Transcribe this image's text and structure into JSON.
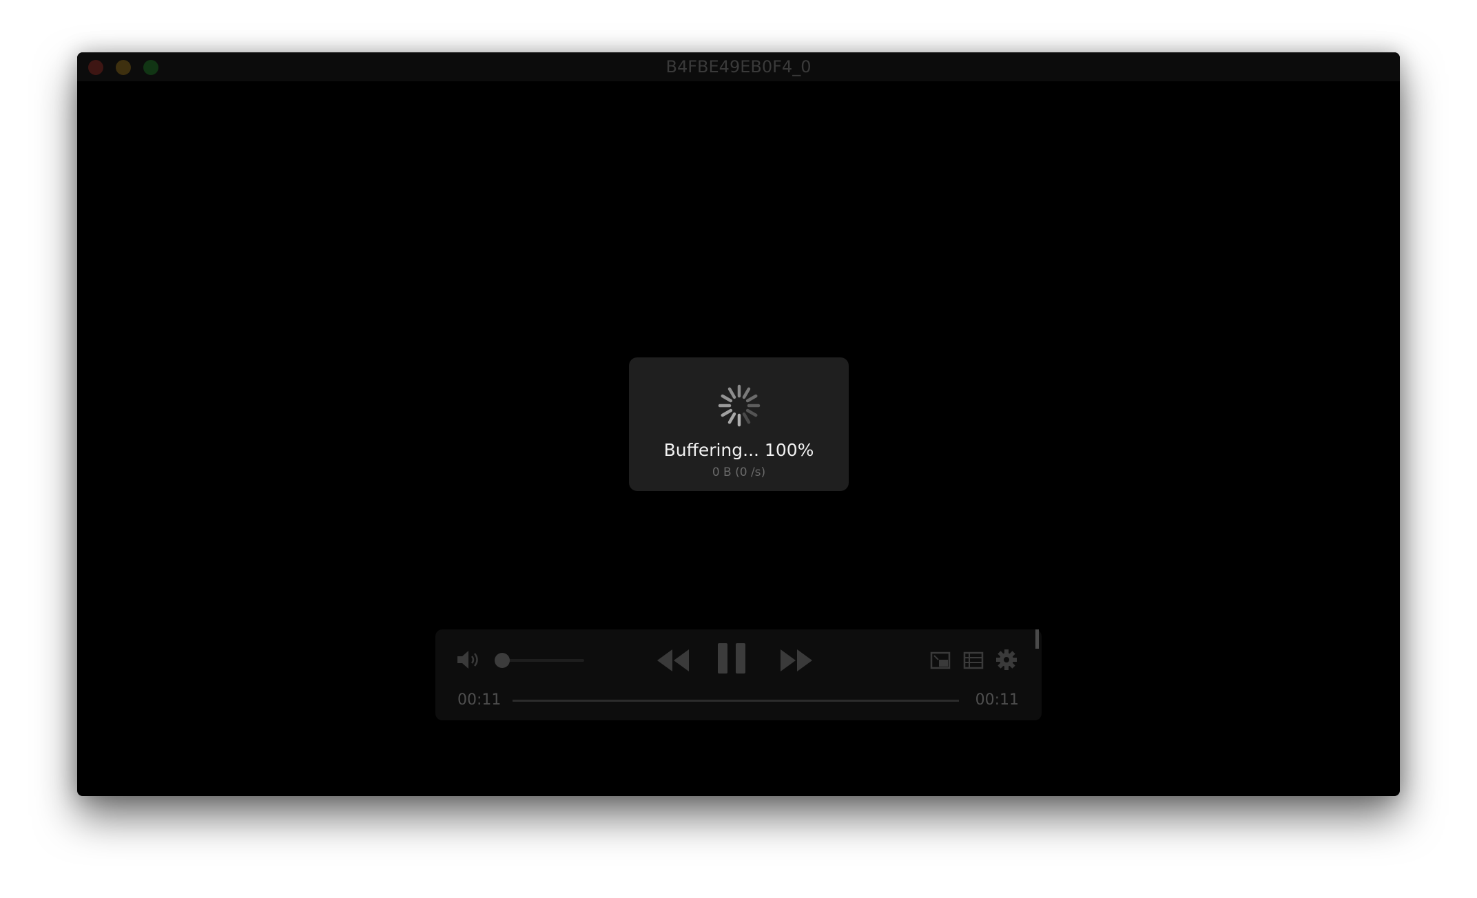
{
  "window": {
    "title": "B4FBE49EB0F4_0"
  },
  "buffering": {
    "status": "Buffering... 100%",
    "rate": "0 B (0 /s)",
    "progress_percent": 100
  },
  "controls": {
    "time_elapsed": "00:11",
    "time_remaining": "00:11",
    "volume_level": 0.0,
    "seek_position": 1.0,
    "icons": {
      "volume": "speaker-volume-icon",
      "rewind": "rewind-icon",
      "pause": "pause-icon",
      "fast_forward": "fast-forward-icon",
      "pip": "picture-in-picture-icon",
      "playlist": "playlist-icon",
      "settings": "gear-icon"
    }
  },
  "colors": {
    "background": "#000000",
    "hud": "#1f1f1f",
    "controls": "#0d0d0d",
    "close": "#3e1613",
    "minimize": "#3e300f",
    "maximize": "#113514"
  }
}
